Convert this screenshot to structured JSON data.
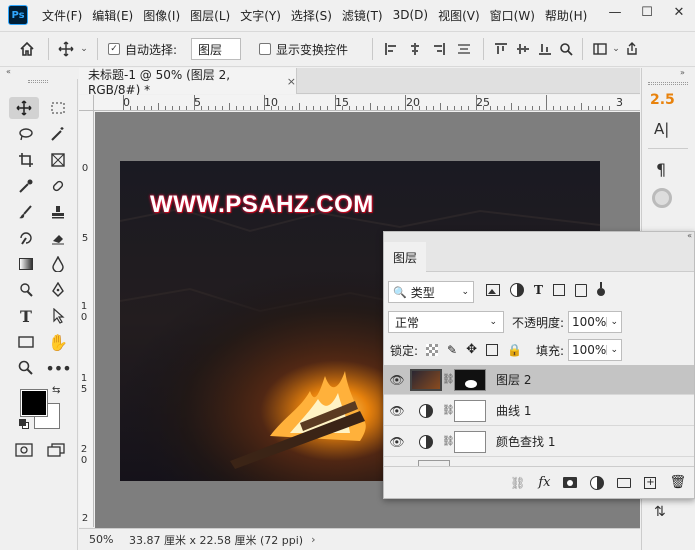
{
  "app": {
    "logo": "Ps"
  },
  "menus": [
    "文件(F)",
    "编辑(E)",
    "图像(I)",
    "图层(L)",
    "文字(Y)",
    "选择(S)",
    "滤镜(T)",
    "3D(D)",
    "视图(V)",
    "窗口(W)",
    "帮助(H)"
  ],
  "window_controls": {
    "minimize": "—",
    "restore": "☐",
    "close": "✕"
  },
  "options": {
    "auto_select_label": "自动选择:",
    "auto_select_checked": true,
    "auto_select_target": "图层",
    "show_transform_label": "显示变换控件",
    "show_transform_checked": false
  },
  "document_tab": {
    "title": "未标题-1 @ 50% (图层 2, RGB/8#) *",
    "close": "×"
  },
  "ruler": {
    "h_labels": [
      "0",
      "5",
      "10",
      "15",
      "20",
      "25",
      "3"
    ],
    "v_labels": [
      "0",
      "5",
      "1 0",
      "1 5",
      "2 0",
      "2"
    ]
  },
  "canvas": {
    "watermark": "WWW.PSAHZ.COM"
  },
  "status": {
    "zoom": "50%",
    "size": "33.87 厘米 x 22.58 厘米 (72 ppi)",
    "arrow": "›"
  },
  "right_panel": {
    "stroke_value": "2.5",
    "char_icon": "A|",
    "para_icon": "¶"
  },
  "layers_panel": {
    "tab_title": "图层",
    "filter_kind": "类型",
    "blend_mode": "正常",
    "opacity_label": "不透明度:",
    "opacity_value": "100%",
    "lock_label": "锁定:",
    "fill_label": "填充:",
    "fill_value": "100%",
    "layers": [
      {
        "name": "图层 2",
        "type": "image",
        "selected": true
      },
      {
        "name": "曲线 1",
        "type": "adjustment",
        "selected": false
      },
      {
        "name": "颜色查找 1",
        "type": "adjustment",
        "selected": false
      }
    ]
  },
  "colors": {
    "foreground": "#000000",
    "background": "#ffffff",
    "accent": "#e8820c",
    "selected_layer": "#c4c4c4"
  }
}
